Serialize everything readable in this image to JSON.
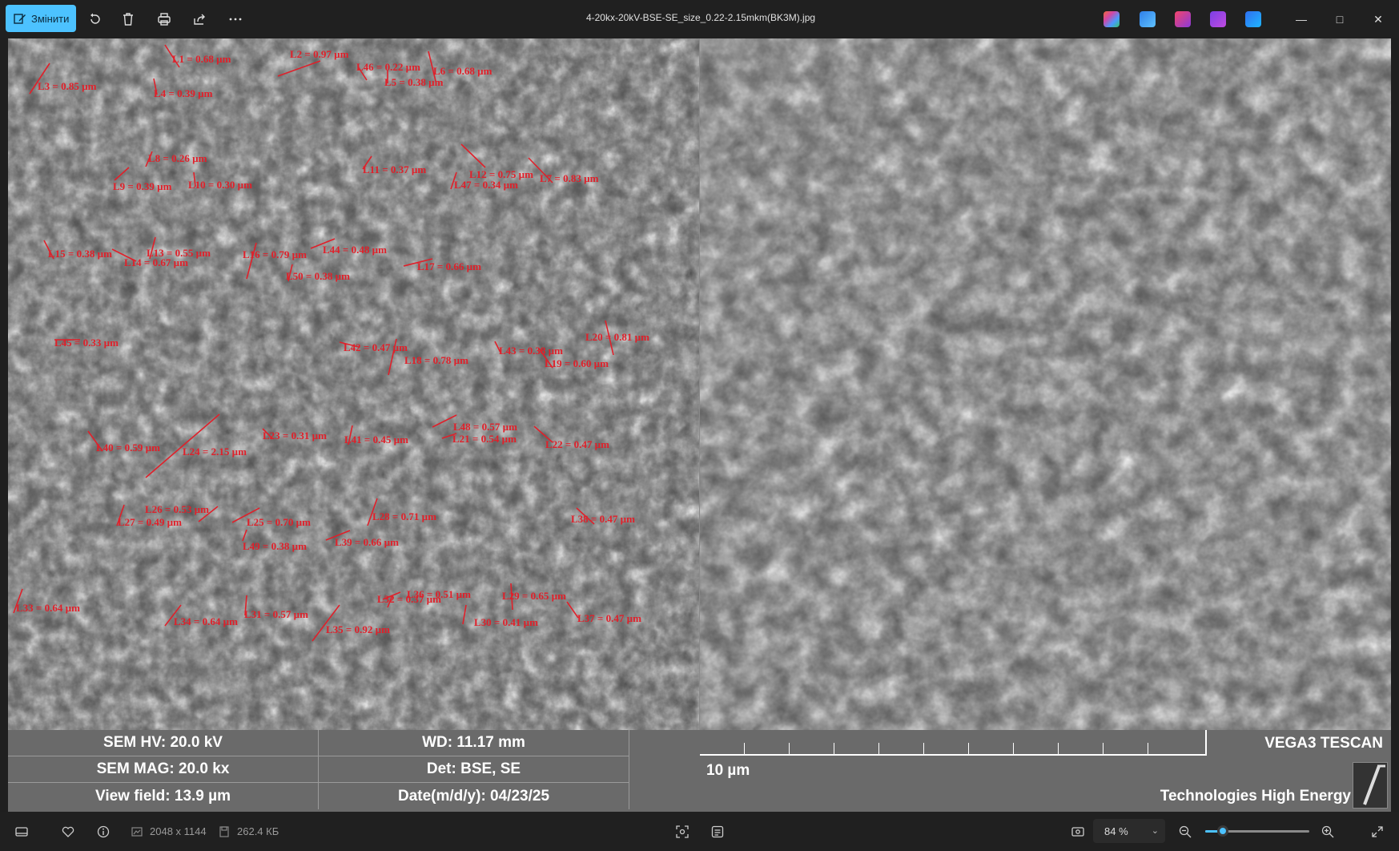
{
  "titlebar": {
    "edit_label": "Змінити",
    "filename": "4-20kx-20kV-BSE-SE_size_0.22-2.15mkm(BK3M).jpg",
    "icons": [
      "rotate-icon",
      "delete-icon",
      "print-icon",
      "share-icon",
      "more-icon"
    ],
    "apps": [
      "copilot-icon",
      "designer-icon",
      "clipchamp-icon",
      "video-editor-icon",
      "onedrive-icon"
    ]
  },
  "measurements": [
    {
      "label": "L1 = 0.68 µm"
    },
    {
      "label": "L2 = 0.97 µm"
    },
    {
      "label": "L46 = 0.22 µm"
    },
    {
      "label": "L6 = 0.68 µm"
    },
    {
      "label": "L3 = 0.85 µm"
    },
    {
      "label": "L4 = 0.39 µm"
    },
    {
      "label": "L5 = 0.38 µm"
    },
    {
      "label": "L8 = 0.26 µm"
    },
    {
      "label": "L9 = 0.39 µm"
    },
    {
      "label": "L10 = 0.30 µm"
    },
    {
      "label": "L11 = 0.37 µm"
    },
    {
      "label": "L12 = 0.75 µm"
    },
    {
      "label": "L47 = 0.34 µm"
    },
    {
      "label": "L7 = 0.83 µm"
    },
    {
      "label": "L15 = 0.38 µm"
    },
    {
      "label": "L13 = 0.55 µm"
    },
    {
      "label": "L14 = 0.67 µm"
    },
    {
      "label": "L16 = 0.79 µm"
    },
    {
      "label": "L44 = 0.48 µm"
    },
    {
      "label": "L50 = 0.38 µm"
    },
    {
      "label": "L17 = 0.66 µm"
    },
    {
      "label": "L45 = 0.33 µm"
    },
    {
      "label": "L42 = 0.47 µm"
    },
    {
      "label": "L18 = 0.78 µm"
    },
    {
      "label": "L43 = 0.38 µm"
    },
    {
      "label": "L20 = 0.81 µm"
    },
    {
      "label": "L19 = 0.60 µm"
    },
    {
      "label": "L40 = 0.59 µm"
    },
    {
      "label": "L24 = 2.15 µm"
    },
    {
      "label": "L23 = 0.31 µm"
    },
    {
      "label": "L41 = 0.45 µm"
    },
    {
      "label": "L48 = 0.57 µm"
    },
    {
      "label": "L21 = 0.54 µm"
    },
    {
      "label": "L22 = 0.47 µm"
    },
    {
      "label": "L26 = 0.53 µm"
    },
    {
      "label": "L27 = 0.49 µm"
    },
    {
      "label": "L25 = 0.70 µm"
    },
    {
      "label": "L28 = 0.71 µm"
    },
    {
      "label": "L38 = 0.47 µm"
    },
    {
      "label": "L49 = 0.38 µm"
    },
    {
      "label": "L39 = 0.66 µm"
    },
    {
      "label": "L33 = 0.64 µm"
    },
    {
      "label": "L36 = 0.51 µm"
    },
    {
      "label": "L32 = 0.37 µm"
    },
    {
      "label": "L29 = 0.65 µm"
    },
    {
      "label": "L34 = 0.64 µm"
    },
    {
      "label": "L31 = 0.57 µm"
    },
    {
      "label": "L35 = 0.92 µm"
    },
    {
      "label": "L30 = 0.41 µm"
    },
    {
      "label": "L37 = 0.47 µm"
    }
  ],
  "infobar": {
    "sem_hv": "SEM HV: 20.0 kV",
    "wd": "WD: 11.17 mm",
    "sem_mag": "SEM MAG: 20.0 kx",
    "det": "Det: BSE, SE",
    "view_field": "View field: 13.9 µm",
    "date": "Date(m/d/y): 04/23/25",
    "scale": "10 µm",
    "brand": "VEGA3 TESCAN",
    "tagline": "Technologies High Energy"
  },
  "statusbar": {
    "dimensions": "2048 x 1144",
    "file_size": "262.4 КБ",
    "zoom": "84 %",
    "zoom_level": 0.17
  }
}
